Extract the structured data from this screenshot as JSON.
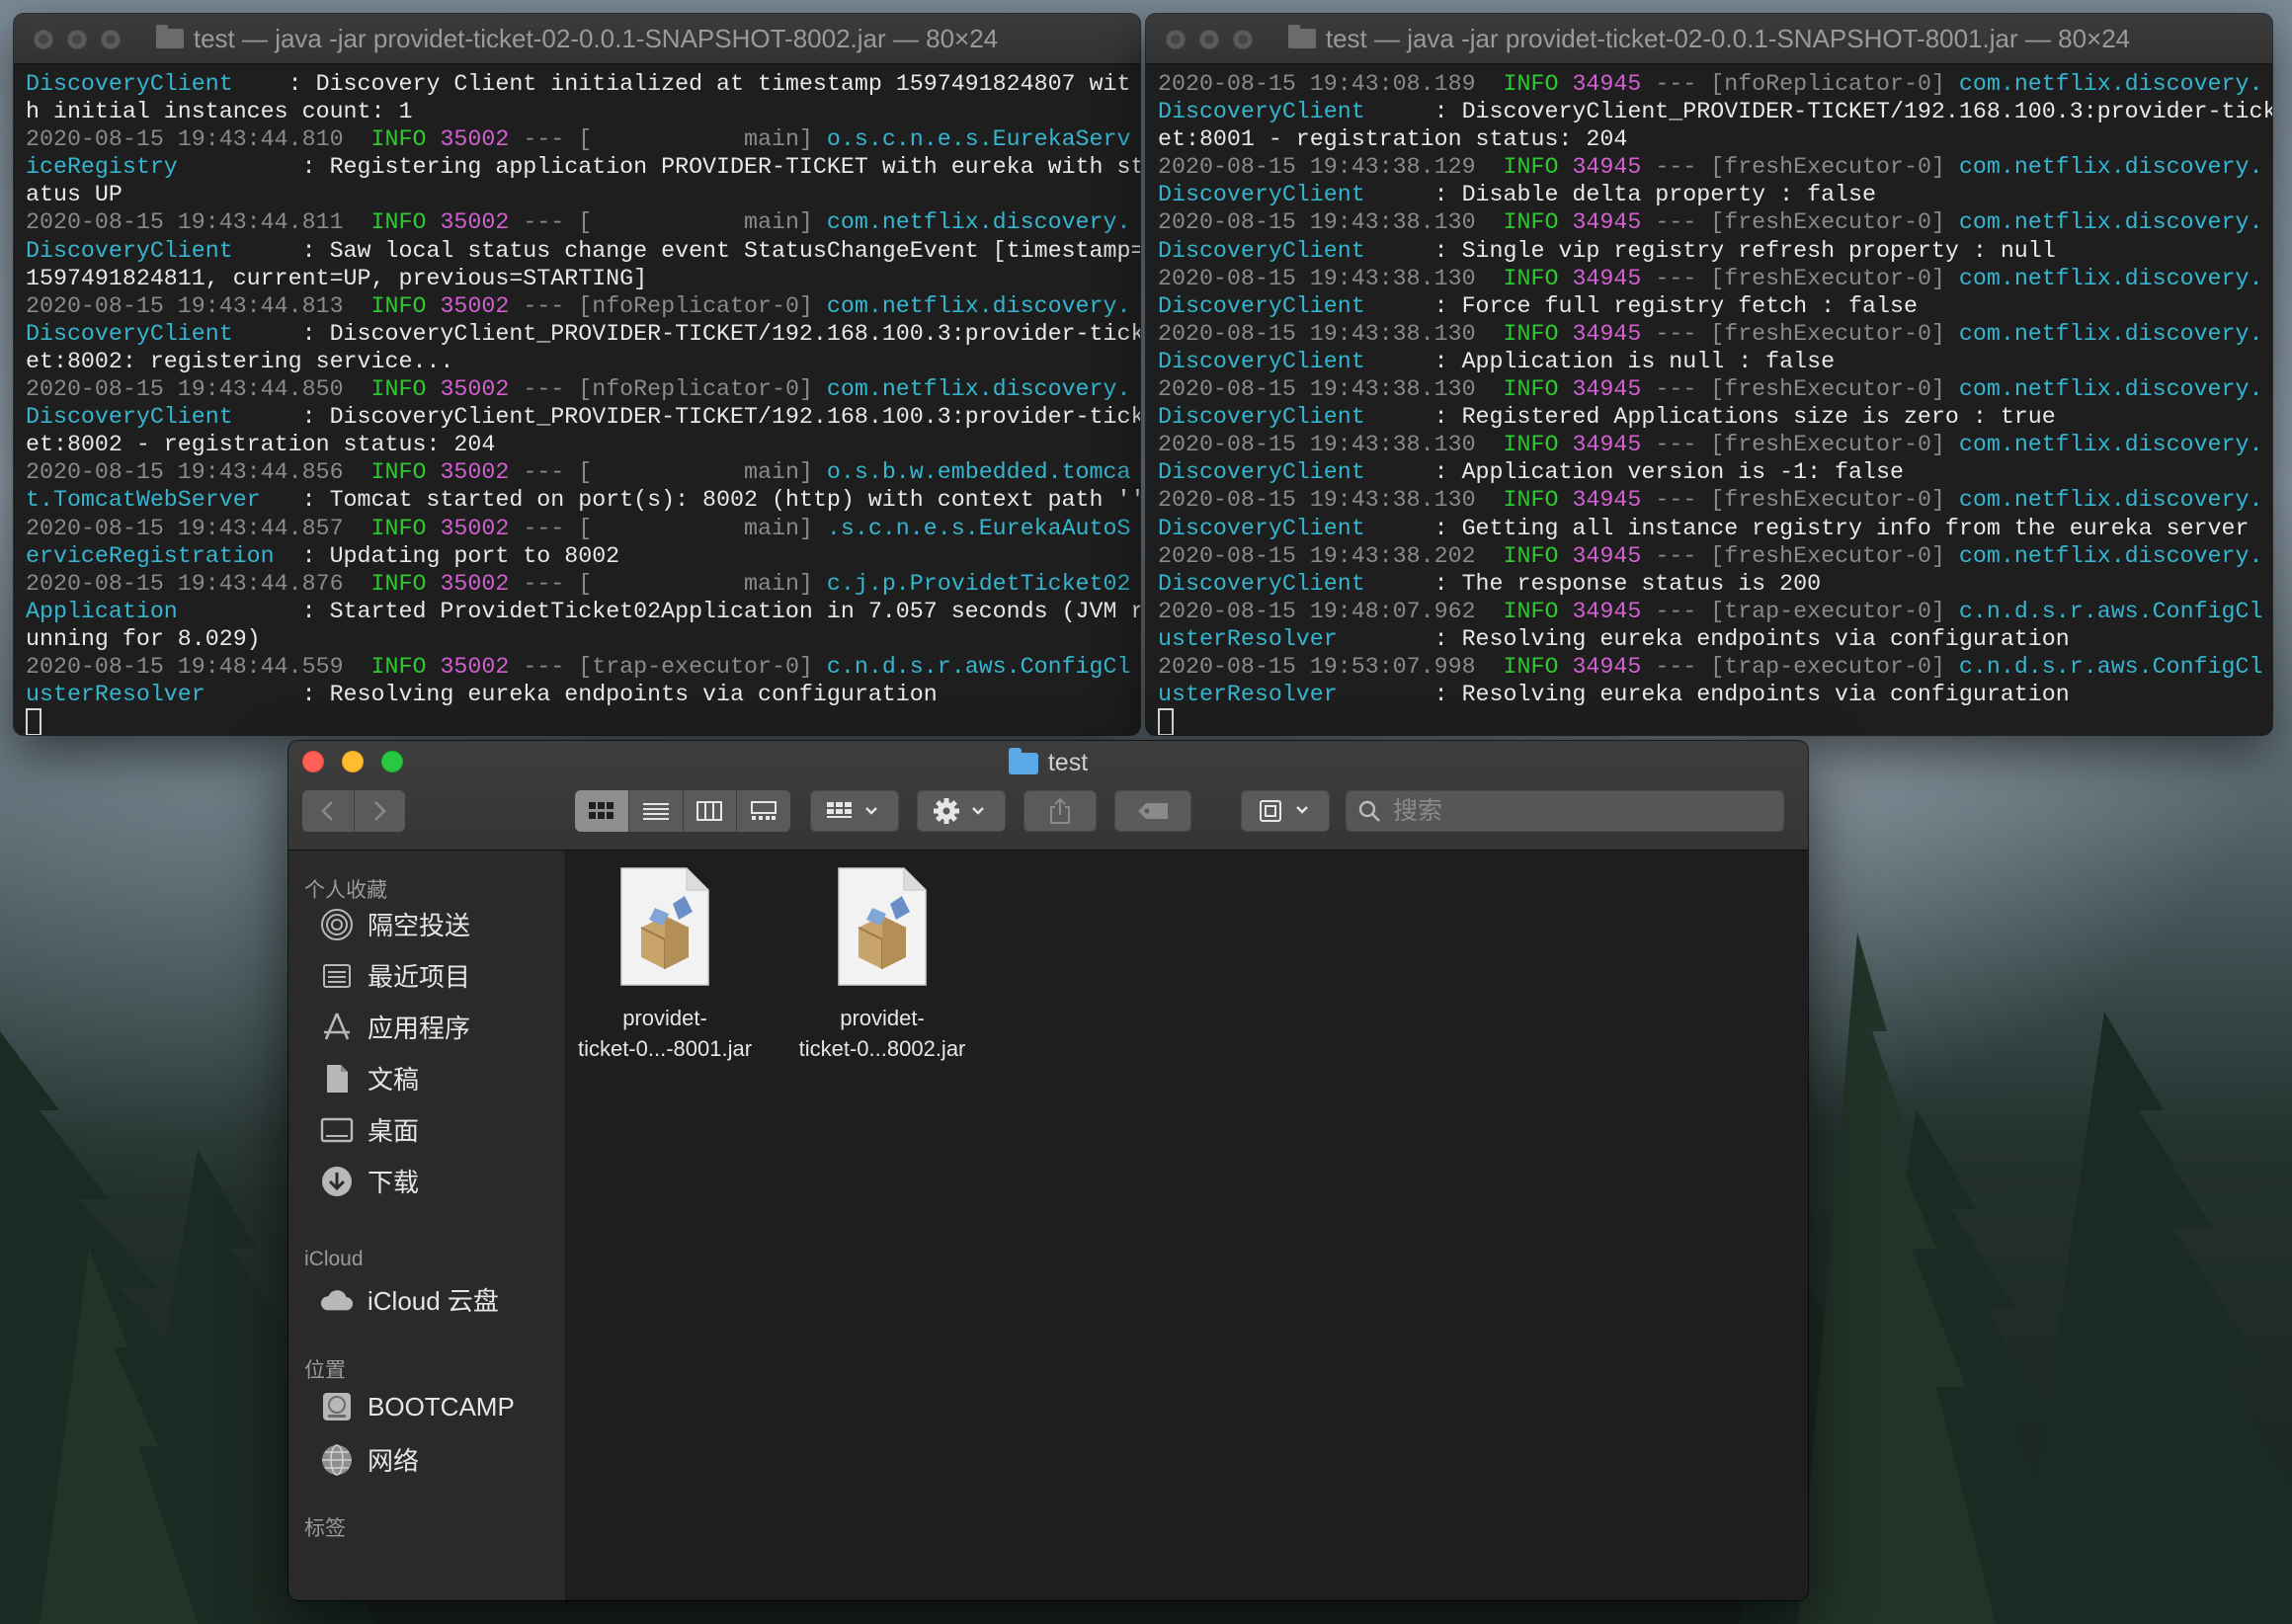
{
  "terminal_left": {
    "title": "test — java -jar providet-ticket-02-0.0.1-SNAPSHOT-8002.jar — 80×24",
    "lines": [
      [
        {
          "t": "DiscoveryClient",
          "c": "cls"
        },
        {
          "t": "    : Discovery Client initialized at timestamp 1597491824807 wit"
        }
      ],
      [
        {
          "t": "h initial instances count: 1"
        }
      ],
      [
        {
          "t": "2020-08-15 19:43:44.810",
          "c": "ts"
        },
        {
          "t": "  "
        },
        {
          "t": "INFO",
          "c": "info"
        },
        {
          "t": " "
        },
        {
          "t": "35002",
          "c": "pid"
        },
        {
          "t": " --- [           main] ",
          "c": "dash"
        },
        {
          "t": "o.s.c.n.e.s.EurekaServ",
          "c": "cls"
        }
      ],
      [
        {
          "t": "iceRegistry",
          "c": "cls"
        },
        {
          "t": "         : Registering application PROVIDER-TICKET with eureka with st"
        }
      ],
      [
        {
          "t": "atus UP"
        }
      ],
      [
        {
          "t": "2020-08-15 19:43:44.811",
          "c": "ts"
        },
        {
          "t": "  "
        },
        {
          "t": "INFO",
          "c": "info"
        },
        {
          "t": " "
        },
        {
          "t": "35002",
          "c": "pid"
        },
        {
          "t": " --- [           main] ",
          "c": "dash"
        },
        {
          "t": "com.netflix.discovery.",
          "c": "cls"
        }
      ],
      [
        {
          "t": "DiscoveryClient",
          "c": "cls"
        },
        {
          "t": "     : Saw local status change event StatusChangeEvent [timestamp="
        }
      ],
      [
        {
          "t": "1597491824811, current=UP, previous=STARTING]"
        }
      ],
      [
        {
          "t": "2020-08-15 19:43:44.813",
          "c": "ts"
        },
        {
          "t": "  "
        },
        {
          "t": "INFO",
          "c": "info"
        },
        {
          "t": " "
        },
        {
          "t": "35002",
          "c": "pid"
        },
        {
          "t": " --- [nfoReplicator-0] ",
          "c": "dash"
        },
        {
          "t": "com.netflix.discovery.",
          "c": "cls"
        }
      ],
      [
        {
          "t": "DiscoveryClient",
          "c": "cls"
        },
        {
          "t": "     : DiscoveryClient_PROVIDER-TICKET/192.168.100.3:provider-tick"
        }
      ],
      [
        {
          "t": "et:8002: registering service..."
        }
      ],
      [
        {
          "t": "2020-08-15 19:43:44.850",
          "c": "ts"
        },
        {
          "t": "  "
        },
        {
          "t": "INFO",
          "c": "info"
        },
        {
          "t": " "
        },
        {
          "t": "35002",
          "c": "pid"
        },
        {
          "t": " --- [nfoReplicator-0] ",
          "c": "dash"
        },
        {
          "t": "com.netflix.discovery.",
          "c": "cls"
        }
      ],
      [
        {
          "t": "DiscoveryClient",
          "c": "cls"
        },
        {
          "t": "     : DiscoveryClient_PROVIDER-TICKET/192.168.100.3:provider-tick"
        }
      ],
      [
        {
          "t": "et:8002 - registration status: 204"
        }
      ],
      [
        {
          "t": "2020-08-15 19:43:44.856",
          "c": "ts"
        },
        {
          "t": "  "
        },
        {
          "t": "INFO",
          "c": "info"
        },
        {
          "t": " "
        },
        {
          "t": "35002",
          "c": "pid"
        },
        {
          "t": " --- [           main] ",
          "c": "dash"
        },
        {
          "t": "o.s.b.w.embedded.tomca",
          "c": "cls"
        }
      ],
      [
        {
          "t": "t.TomcatWebServer",
          "c": "cls"
        },
        {
          "t": "   : Tomcat started on port(s): 8002 (http) with context path ''"
        }
      ],
      [
        {
          "t": "2020-08-15 19:43:44.857",
          "c": "ts"
        },
        {
          "t": "  "
        },
        {
          "t": "INFO",
          "c": "info"
        },
        {
          "t": " "
        },
        {
          "t": "35002",
          "c": "pid"
        },
        {
          "t": " --- [           main] ",
          "c": "dash"
        },
        {
          "t": ".s.c.n.e.s.EurekaAutoS",
          "c": "cls"
        }
      ],
      [
        {
          "t": "erviceRegistration",
          "c": "cls"
        },
        {
          "t": "  : Updating port to 8002"
        }
      ],
      [
        {
          "t": "2020-08-15 19:43:44.876",
          "c": "ts"
        },
        {
          "t": "  "
        },
        {
          "t": "INFO",
          "c": "info"
        },
        {
          "t": " "
        },
        {
          "t": "35002",
          "c": "pid"
        },
        {
          "t": " --- [           main] ",
          "c": "dash"
        },
        {
          "t": "c.j.p.ProvidetTicket02",
          "c": "cls"
        }
      ],
      [
        {
          "t": "Application",
          "c": "cls"
        },
        {
          "t": "         : Started ProvidetTicket02Application in 7.057 seconds (JVM r"
        }
      ],
      [
        {
          "t": "unning for 8.029)"
        }
      ],
      [
        {
          "t": "2020-08-15 19:48:44.559",
          "c": "ts"
        },
        {
          "t": "  "
        },
        {
          "t": "INFO",
          "c": "info"
        },
        {
          "t": " "
        },
        {
          "t": "35002",
          "c": "pid"
        },
        {
          "t": " --- [trap-executor-0] ",
          "c": "dash"
        },
        {
          "t": "c.n.d.s.r.aws.ConfigCl",
          "c": "cls"
        }
      ],
      [
        {
          "t": "usterResolver",
          "c": "cls"
        },
        {
          "t": "       : Resolving eureka endpoints via configuration"
        }
      ]
    ]
  },
  "terminal_right": {
    "title": "test — java -jar providet-ticket-02-0.0.1-SNAPSHOT-8001.jar — 80×24",
    "lines": [
      [
        {
          "t": "2020-08-15 19:43:08.189",
          "c": "ts"
        },
        {
          "t": "  "
        },
        {
          "t": "INFO",
          "c": "info"
        },
        {
          "t": " "
        },
        {
          "t": "34945",
          "c": "pid"
        },
        {
          "t": " --- [nfoReplicator-0] ",
          "c": "dash"
        },
        {
          "t": "com.netflix.discovery.",
          "c": "cls"
        }
      ],
      [
        {
          "t": "DiscoveryClient",
          "c": "cls"
        },
        {
          "t": "     : DiscoveryClient_PROVIDER-TICKET/192.168.100.3:provider-tick"
        }
      ],
      [
        {
          "t": "et:8001 - registration status: 204"
        }
      ],
      [
        {
          "t": "2020-08-15 19:43:38.129",
          "c": "ts"
        },
        {
          "t": "  "
        },
        {
          "t": "INFO",
          "c": "info"
        },
        {
          "t": " "
        },
        {
          "t": "34945",
          "c": "pid"
        },
        {
          "t": " --- [freshExecutor-0] ",
          "c": "dash"
        },
        {
          "t": "com.netflix.discovery.",
          "c": "cls"
        }
      ],
      [
        {
          "t": "DiscoveryClient",
          "c": "cls"
        },
        {
          "t": "     : Disable delta property : false"
        }
      ],
      [
        {
          "t": "2020-08-15 19:43:38.130",
          "c": "ts"
        },
        {
          "t": "  "
        },
        {
          "t": "INFO",
          "c": "info"
        },
        {
          "t": " "
        },
        {
          "t": "34945",
          "c": "pid"
        },
        {
          "t": " --- [freshExecutor-0] ",
          "c": "dash"
        },
        {
          "t": "com.netflix.discovery.",
          "c": "cls"
        }
      ],
      [
        {
          "t": "DiscoveryClient",
          "c": "cls"
        },
        {
          "t": "     : Single vip registry refresh property : null"
        }
      ],
      [
        {
          "t": "2020-08-15 19:43:38.130",
          "c": "ts"
        },
        {
          "t": "  "
        },
        {
          "t": "INFO",
          "c": "info"
        },
        {
          "t": " "
        },
        {
          "t": "34945",
          "c": "pid"
        },
        {
          "t": " --- [freshExecutor-0] ",
          "c": "dash"
        },
        {
          "t": "com.netflix.discovery.",
          "c": "cls"
        }
      ],
      [
        {
          "t": "DiscoveryClient",
          "c": "cls"
        },
        {
          "t": "     : Force full registry fetch : false"
        }
      ],
      [
        {
          "t": "2020-08-15 19:43:38.130",
          "c": "ts"
        },
        {
          "t": "  "
        },
        {
          "t": "INFO",
          "c": "info"
        },
        {
          "t": " "
        },
        {
          "t": "34945",
          "c": "pid"
        },
        {
          "t": " --- [freshExecutor-0] ",
          "c": "dash"
        },
        {
          "t": "com.netflix.discovery.",
          "c": "cls"
        }
      ],
      [
        {
          "t": "DiscoveryClient",
          "c": "cls"
        },
        {
          "t": "     : Application is null : false"
        }
      ],
      [
        {
          "t": "2020-08-15 19:43:38.130",
          "c": "ts"
        },
        {
          "t": "  "
        },
        {
          "t": "INFO",
          "c": "info"
        },
        {
          "t": " "
        },
        {
          "t": "34945",
          "c": "pid"
        },
        {
          "t": " --- [freshExecutor-0] ",
          "c": "dash"
        },
        {
          "t": "com.netflix.discovery.",
          "c": "cls"
        }
      ],
      [
        {
          "t": "DiscoveryClient",
          "c": "cls"
        },
        {
          "t": "     : Registered Applications size is zero : true"
        }
      ],
      [
        {
          "t": "2020-08-15 19:43:38.130",
          "c": "ts"
        },
        {
          "t": "  "
        },
        {
          "t": "INFO",
          "c": "info"
        },
        {
          "t": " "
        },
        {
          "t": "34945",
          "c": "pid"
        },
        {
          "t": " --- [freshExecutor-0] ",
          "c": "dash"
        },
        {
          "t": "com.netflix.discovery.",
          "c": "cls"
        }
      ],
      [
        {
          "t": "DiscoveryClient",
          "c": "cls"
        },
        {
          "t": "     : Application version is -1: false"
        }
      ],
      [
        {
          "t": "2020-08-15 19:43:38.130",
          "c": "ts"
        },
        {
          "t": "  "
        },
        {
          "t": "INFO",
          "c": "info"
        },
        {
          "t": " "
        },
        {
          "t": "34945",
          "c": "pid"
        },
        {
          "t": " --- [freshExecutor-0] ",
          "c": "dash"
        },
        {
          "t": "com.netflix.discovery.",
          "c": "cls"
        }
      ],
      [
        {
          "t": "DiscoveryClient",
          "c": "cls"
        },
        {
          "t": "     : Getting all instance registry info from the eureka server"
        }
      ],
      [
        {
          "t": "2020-08-15 19:43:38.202",
          "c": "ts"
        },
        {
          "t": "  "
        },
        {
          "t": "INFO",
          "c": "info"
        },
        {
          "t": " "
        },
        {
          "t": "34945",
          "c": "pid"
        },
        {
          "t": " --- [freshExecutor-0] ",
          "c": "dash"
        },
        {
          "t": "com.netflix.discovery.",
          "c": "cls"
        }
      ],
      [
        {
          "t": "DiscoveryClient",
          "c": "cls"
        },
        {
          "t": "     : The response status is 200"
        }
      ],
      [
        {
          "t": "2020-08-15 19:48:07.962",
          "c": "ts"
        },
        {
          "t": "  "
        },
        {
          "t": "INFO",
          "c": "info"
        },
        {
          "t": " "
        },
        {
          "t": "34945",
          "c": "pid"
        },
        {
          "t": " --- [trap-executor-0] ",
          "c": "dash"
        },
        {
          "t": "c.n.d.s.r.aws.ConfigCl",
          "c": "cls"
        }
      ],
      [
        {
          "t": "usterResolver",
          "c": "cls"
        },
        {
          "t": "       : Resolving eureka endpoints via configuration"
        }
      ],
      [
        {
          "t": "2020-08-15 19:53:07.998",
          "c": "ts"
        },
        {
          "t": "  "
        },
        {
          "t": "INFO",
          "c": "info"
        },
        {
          "t": " "
        },
        {
          "t": "34945",
          "c": "pid"
        },
        {
          "t": " --- [trap-executor-0] ",
          "c": "dash"
        },
        {
          "t": "c.n.d.s.r.aws.ConfigCl",
          "c": "cls"
        }
      ],
      [
        {
          "t": "usterResolver",
          "c": "cls"
        },
        {
          "t": "       : Resolving eureka endpoints via configuration"
        }
      ]
    ]
  },
  "finder": {
    "title": "test",
    "search_placeholder": "搜索",
    "sidebar": {
      "favorites_heading": "个人收藏",
      "favorites": [
        {
          "label": "隔空投送",
          "icon": "airdrop-icon"
        },
        {
          "label": "最近项目",
          "icon": "recents-icon"
        },
        {
          "label": "应用程序",
          "icon": "applications-icon"
        },
        {
          "label": "文稿",
          "icon": "documents-icon"
        },
        {
          "label": "桌面",
          "icon": "desktop-icon"
        },
        {
          "label": "下载",
          "icon": "downloads-icon"
        }
      ],
      "icloud_heading": "iCloud",
      "icloud": [
        {
          "label": "iCloud 云盘",
          "icon": "cloud-icon"
        }
      ],
      "locations_heading": "位置",
      "locations": [
        {
          "label": "BOOTCAMP",
          "icon": "disk-icon"
        },
        {
          "label": "网络",
          "icon": "network-icon"
        }
      ],
      "tags_heading": "标签"
    },
    "files": [
      {
        "name": "providet-\nticket-0...-8001.jar",
        "icon": "jar-archive-icon"
      },
      {
        "name": "providet-\nticket-0...8002.jar",
        "icon": "jar-archive-icon"
      }
    ]
  },
  "colors": {
    "timestamp": "#8a8a8a",
    "info": "#30c830",
    "pid": "#d35fd3",
    "class": "#35b5cf",
    "text": "#e8e8e8",
    "folder_accent": "#5aa9e6"
  }
}
